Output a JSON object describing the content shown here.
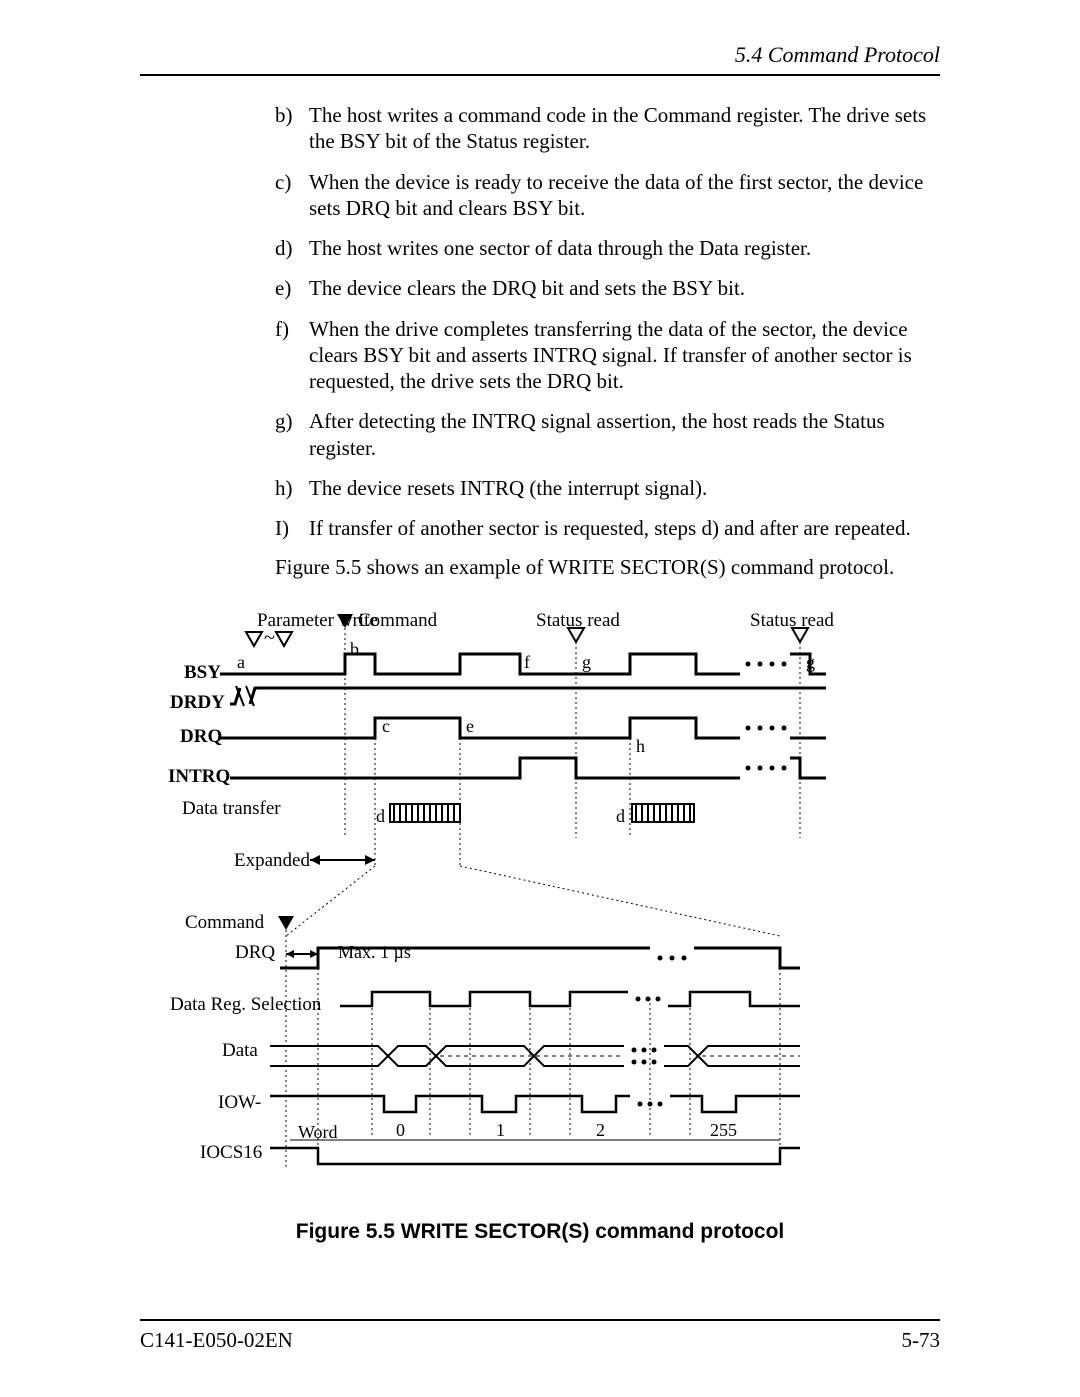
{
  "header": {
    "section": "5.4  Command Protocol"
  },
  "list": [
    {
      "marker": "b)",
      "text": "The host writes a command code in the Command register. The drive sets the BSY bit of the Status register."
    },
    {
      "marker": "c)",
      "text": "When the device is ready to receive the data of the first sector, the device sets DRQ bit and clears BSY bit."
    },
    {
      "marker": "d)",
      "text": "The host writes one sector of data through the Data register."
    },
    {
      "marker": "e)",
      "text": "The device clears the DRQ bit and sets the BSY bit."
    },
    {
      "marker": "f)",
      "text": "When the drive completes transferring the data of the sector, the device clears BSY bit and asserts INTRQ signal.  If transfer of another sector is requested, the drive sets the DRQ bit."
    },
    {
      "marker": "g)",
      "text": "After detecting the INTRQ signal assertion, the host reads the Status register."
    },
    {
      "marker": "h)",
      "text": "The device resets INTRQ (the interrupt signal)."
    },
    {
      "marker": "I)",
      "text": "If transfer of another sector is requested, steps d) and after are repeated."
    }
  ],
  "caption_para": "Figure 5.5 shows an example of WRITE SECTOR(S) command protocol.",
  "figure": {
    "caption": "Figure 5.5  WRITE SECTOR(S) command protocol",
    "top_labels": {
      "param_write": "Parameter write",
      "command": "Command",
      "status_read1": "Status read",
      "status_read2": "Status read"
    },
    "waves": {
      "bsy": "BSY",
      "drdy": "DRDY",
      "drq": "DRQ",
      "intrq": "INTRQ",
      "data_transfer": "Data transfer",
      "expanded": "Expanded",
      "command2": "Command",
      "drq2": "DRQ",
      "max1us": "Max. 1 µs",
      "data_reg_sel": "Data Reg. Selection",
      "data": "Data",
      "iow": "IOW-",
      "iocs16": "IOCS16",
      "word": "Word"
    },
    "point_labels": {
      "a": "a",
      "b": "b",
      "c": "c",
      "d": "d",
      "e": "e",
      "f": "f",
      "g": "g",
      "h": "h"
    },
    "word_numbers": [
      "0",
      "1",
      "2",
      "255"
    ]
  },
  "footer": {
    "left": "C141-E050-02EN",
    "right": "5-73"
  }
}
